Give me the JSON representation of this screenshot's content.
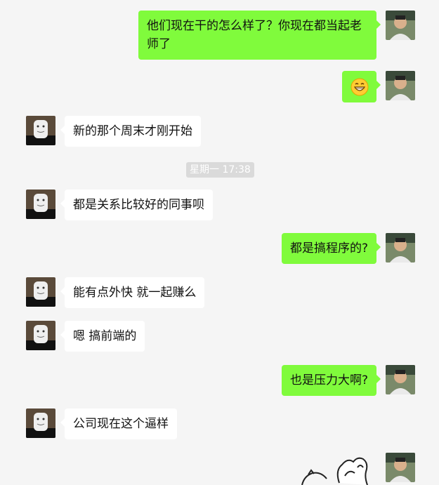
{
  "chat": {
    "messages": [
      {
        "side": "out",
        "text": "他们现在干的怎么样了？你现在都当起老师了"
      },
      {
        "side": "out",
        "type": "emoji",
        "icon": "grinning-face-emoji"
      },
      {
        "side": "in",
        "text": "新的那个周末才刚开始"
      },
      {
        "type": "timestamp",
        "text": "星期一 17:38"
      },
      {
        "side": "in",
        "text": "都是关系比较好的同事呗"
      },
      {
        "side": "out",
        "text": "都是搞程序的?"
      },
      {
        "side": "in",
        "text": "能有点外快 就一起赚么"
      },
      {
        "side": "in",
        "text": "嗯 搞前端的"
      },
      {
        "side": "out",
        "text": "也是压力大啊?"
      },
      {
        "side": "in",
        "text": "公司现在这个逼样"
      },
      {
        "side": "out",
        "type": "sticker",
        "icon": "rabbit-sticker"
      }
    ]
  },
  "colors": {
    "background": "#f5f5f5",
    "outgoing_bubble": "#80fb3c",
    "incoming_bubble": "#ffffff",
    "timestamp_bg": "#dadada"
  }
}
